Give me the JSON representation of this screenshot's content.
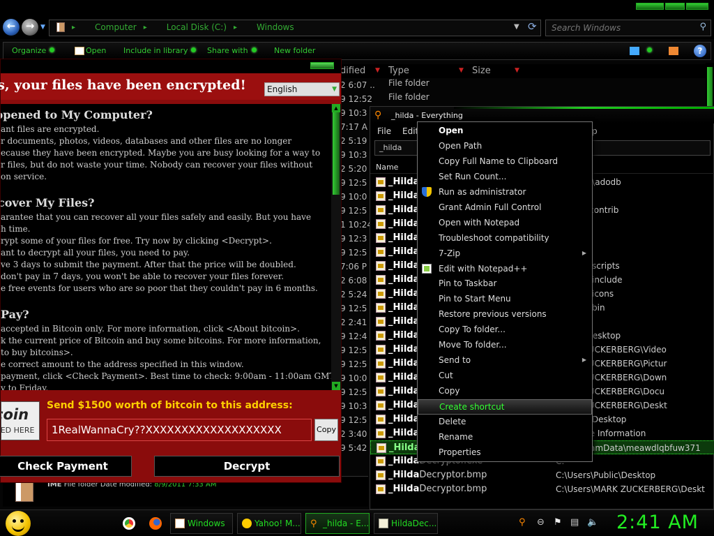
{
  "explorer": {
    "breadcrumbs": [
      "Computer",
      "Local Disk (C:)",
      "Windows"
    ],
    "search_placeholder": "Search Windows",
    "toolbar": {
      "organize": "Organize",
      "open": "Open",
      "include": "Include in library",
      "share": "Share with",
      "new_folder": "New folder"
    },
    "columns": {
      "modified": "dified",
      "type": "Type",
      "size": "Size"
    },
    "rows": [
      "2 6:07 ...",
      "9 12:52",
      "9 10:3",
      "7:17 A",
      "2 5:19",
      "9 10:3",
      "2 5:20",
      "9 12:5",
      "9 10:0",
      "9 12:5",
      "1 10:24",
      "9 12:3",
      "9 12:5",
      "7:06 P",
      "2 6:08",
      "2 5:24",
      "9 12:5",
      "2 2:41",
      "9 12:4",
      "9 12:5",
      "9 12:5",
      "9 10:0",
      "9 12:5",
      "9 10:3",
      "9 12:5",
      "2 3:40",
      "9 5:42"
    ],
    "folder_rows": [
      "File folder",
      "File folder"
    ],
    "status": {
      "name": "IME",
      "text": "File folder  Date modified:",
      "date": "8/9/2011 7:33 AM"
    }
  },
  "wannacry": {
    "title": "ps, your files have been encrypted!",
    "language": "English",
    "sections": [
      {
        "heading": "ppened to My Computer?",
        "lines": [
          "ant files are encrypted.",
          "r documents, photos, videos, databases and other files are no longer",
          "ecause they have been encrypted. Maybe you are busy looking for a way to",
          "r files, but do not waste your time. Nobody can recover your files without",
          "on service."
        ]
      },
      {
        "heading": "cover My Files?",
        "lines": [
          "arantee that you can recover all your files safely and easily. But you have",
          "h time.",
          "rypt some of your files for free. Try now by clicking <Decrypt>.",
          "ant to decrypt all your files, you need to pay.",
          "ve 3 days to submit the payment. After that the price will be doubled.",
          "don't pay in 7 days, you won't be able to recover your files forever.",
          "e free events for users who are so poor that they couldn't pay in 6 months."
        ]
      },
      {
        "heading": " Pay?",
        "lines": [
          "accepted in Bitcoin only. For more information, click <About bitcoin>.",
          "k the current price of Bitcoin and buy some bitcoins. For more information,",
          "to buy bitcoins>.",
          "e correct amount to the address specified in this window.",
          "payment, click <Check Payment>. Best time to check: 9:00am - 11:00am GMT",
          "y to Friday."
        ]
      }
    ],
    "bitcoin_logo": {
      "line1": "coin",
      "line2": "TED HERE"
    },
    "send_label": "Send $1500 worth of bitcoin to this address:",
    "address": "1RealWannaCry??XXXXXXXXXXXXXXXXXXX",
    "copy_label": "Copy",
    "check_payment": "Check Payment",
    "decrypt": "Decrypt"
  },
  "everything": {
    "title": "_hilda - Everything",
    "menu": {
      "file": "File",
      "edit": "Edit",
      "help": "p"
    },
    "search_value": "_hilda",
    "column_name": "Name",
    "rows": [
      {
        "name": "_Hilda",
        "rest": "",
        "path": "\\licenses\\adodb"
      },
      {
        "name": "_Hilda",
        "rest": "",
        "path": "\\install"
      },
      {
        "name": "_Hilda",
        "rest": "",
        "path": "\\htdocs\\contrib"
      },
      {
        "name": "_Hilda",
        "rest": "",
        "path": "\\htdocs"
      },
      {
        "name": "_Hilda",
        "rest": "",
        "path": "\\contrib"
      },
      {
        "name": "_Hilda",
        "rest": "",
        "path": "\\cgi-bin"
      },
      {
        "name": "_Hilda",
        "rest": "",
        "path": "\\apache\\scripts"
      },
      {
        "name": "_Hilda",
        "rest": "",
        "path": "\\apache\\include"
      },
      {
        "name": "_Hilda",
        "rest": "",
        "path": "\\apache\\icons"
      },
      {
        "name": "_Hilda",
        "rest": "",
        "path": "\\apache\\bin"
      },
      {
        "name": "_Hilda",
        "rest": "",
        "path": "\\apache"
      },
      {
        "name": "_Hilda",
        "rest": "",
        "path": "\\Public\\Desktop"
      },
      {
        "name": "_Hilda",
        "rest": "",
        "path": "MARK ZUCKERBERG\\Video"
      },
      {
        "name": "_Hilda",
        "rest": "",
        "path": "MARK ZUCKERBERG\\Pictur"
      },
      {
        "name": "_Hilda",
        "rest": "",
        "path": "MARK ZUCKERBERG\\Down"
      },
      {
        "name": "_Hilda",
        "rest": "",
        "path": "MARK ZUCKERBERG\\Docu"
      },
      {
        "name": "_Hilda",
        "rest": "",
        "path": "MARK ZUCKERBERG\\Deskt"
      },
      {
        "name": "_Hilda",
        "rest": "",
        "path": "\\Default\\Desktop"
      },
      {
        "name": "_Hilda",
        "rest": "",
        "path": "n Volume Information"
      },
      {
        "name": "_Hilda",
        "rest": "Decryptor.exe",
        "path": "C:\\ProgramData\\meawdlqbfuw371"
      },
      {
        "name": "_Hilda",
        "rest": "Decryptor.exe",
        "path": "C:"
      },
      {
        "name": "_Hilda",
        "rest": "Decryptor.bmp",
        "path": "C:\\Users\\Public\\Desktop"
      },
      {
        "name": "_Hilda",
        "rest": "Decryptor.bmp",
        "path": "C:\\Users\\MARK ZUCKERBERG\\Deskt"
      }
    ]
  },
  "context_menu": {
    "items": [
      "Open",
      "Open Path",
      "Copy Full Name to Clipboard",
      "Set Run Count...",
      "Run as administrator",
      "Grant Admin Full Control",
      "Open with Notepad",
      "Troubleshoot compatibility",
      "7-Zip",
      "Edit with Notepad++",
      "Pin to Taskbar",
      "Pin to Start Menu",
      "Restore previous versions",
      "Copy To folder...",
      "Move To folder...",
      "Send to",
      "Cut",
      "Copy",
      "Create shortcut",
      "Delete",
      "Rename",
      "Properties"
    ]
  },
  "taskbar": {
    "windows": "Windows",
    "yahoo": "Yahoo! M...",
    "everything": "_hilda - E...",
    "hilda": "HildaDec...",
    "clock": "2:41 AM"
  }
}
